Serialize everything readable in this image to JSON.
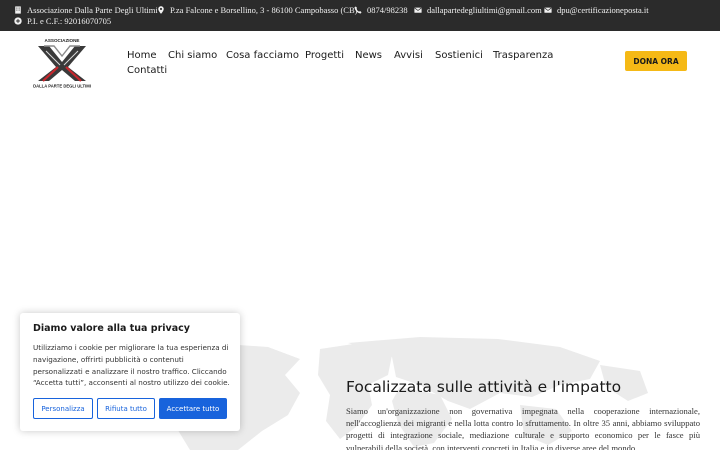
{
  "topbar": {
    "org_name": "Associazione Dalla Parte Degli Ultimi",
    "address": "P.za Falcone e Borsellino, 3 - 86100 Campobasso (CB)",
    "phone": "0874/98238",
    "email": "dallapartedegliultimi@gmail.com",
    "pec": "dpu@certificazioneposta.it",
    "vat": "P.I. e C.F.: 92016070705"
  },
  "logo": {
    "top_text": "ASSOCIAZIONE",
    "bottom_text": "DALLA PARTE DEGLI ULTIMI"
  },
  "nav": {
    "items": [
      "Home",
      "Chi siamo",
      "Cosa facciamo",
      "Progetti",
      "News",
      "Avvisi",
      "Sostienici",
      "Trasparenza",
      "Contatti"
    ]
  },
  "donate_label": "DONA ORA",
  "content": {
    "title": "Focalizzata sulle attività e l'impatto",
    "text": "Siamo un'organizzazione non governativa impegnata nella cooperazione internazionale, nell'accoglienza dei migranti e nella lotta contro lo sfruttamento. In oltre 35 anni, abbiamo sviluppato progetti di integrazione sociale, mediazione culturale e supporto economico per le fasce più vulnerabili della società, con interventi concreti in Italia e in diverse aree del mondo."
  },
  "cookie": {
    "title": "Diamo valore alla tua privacy",
    "text": "Utilizziamo i cookie per migliorare la tua esperienza di navigazione, offrirti pubblicità o contenuti personalizzati e analizzare il nostro traffico. Cliccando “Accetta tutti”, acconsenti al nostro utilizzo dei cookie.",
    "customize_label": "Personalizza",
    "reject_label": "Rifiuta tutto",
    "accept_label": "Accettare tutto"
  },
  "colors": {
    "topbar_bg": "#2b2b2b",
    "donate_bg": "#f5b916",
    "cookie_accent": "#1863dc"
  }
}
